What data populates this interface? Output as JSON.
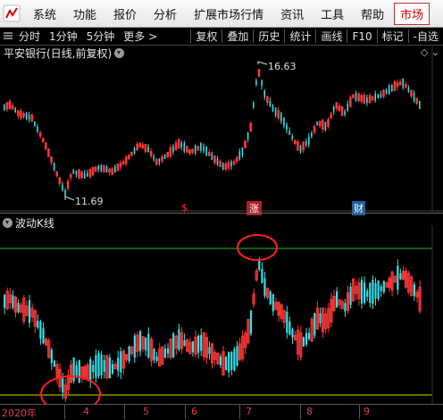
{
  "menu": {
    "items": [
      "系统",
      "功能",
      "报价",
      "分析",
      "扩展市场行情",
      "资讯",
      "工具",
      "帮助"
    ],
    "active": "市场"
  },
  "toolbar": {
    "periods": [
      "分时",
      "1分钟",
      "5分钟",
      "更多 >"
    ],
    "tools": [
      "复权",
      "叠加",
      "历史",
      "统计",
      "画线",
      "F10",
      "标记",
      "-自选"
    ]
  },
  "main_chart": {
    "title": "平安银行(日线,前复权)",
    "high_label": "16.63",
    "low_label": "11.69",
    "markers": [
      {
        "text": "$",
        "color": "#ff3030"
      },
      {
        "text": "涨",
        "color": "#ffffff"
      },
      {
        "text": "财",
        "color": "#40c0ff"
      }
    ]
  },
  "indicator": {
    "title": "波动K线",
    "upper_line_color": "#22bb22",
    "lower_line_color": "#dddd00",
    "highlight_color": "#ff2020"
  },
  "xaxis": {
    "labels": [
      "2020年",
      "4",
      "5",
      "6",
      "7",
      "8",
      "9"
    ]
  },
  "colors": {
    "up": "#ff3838",
    "down": "#38e0e8"
  }
}
